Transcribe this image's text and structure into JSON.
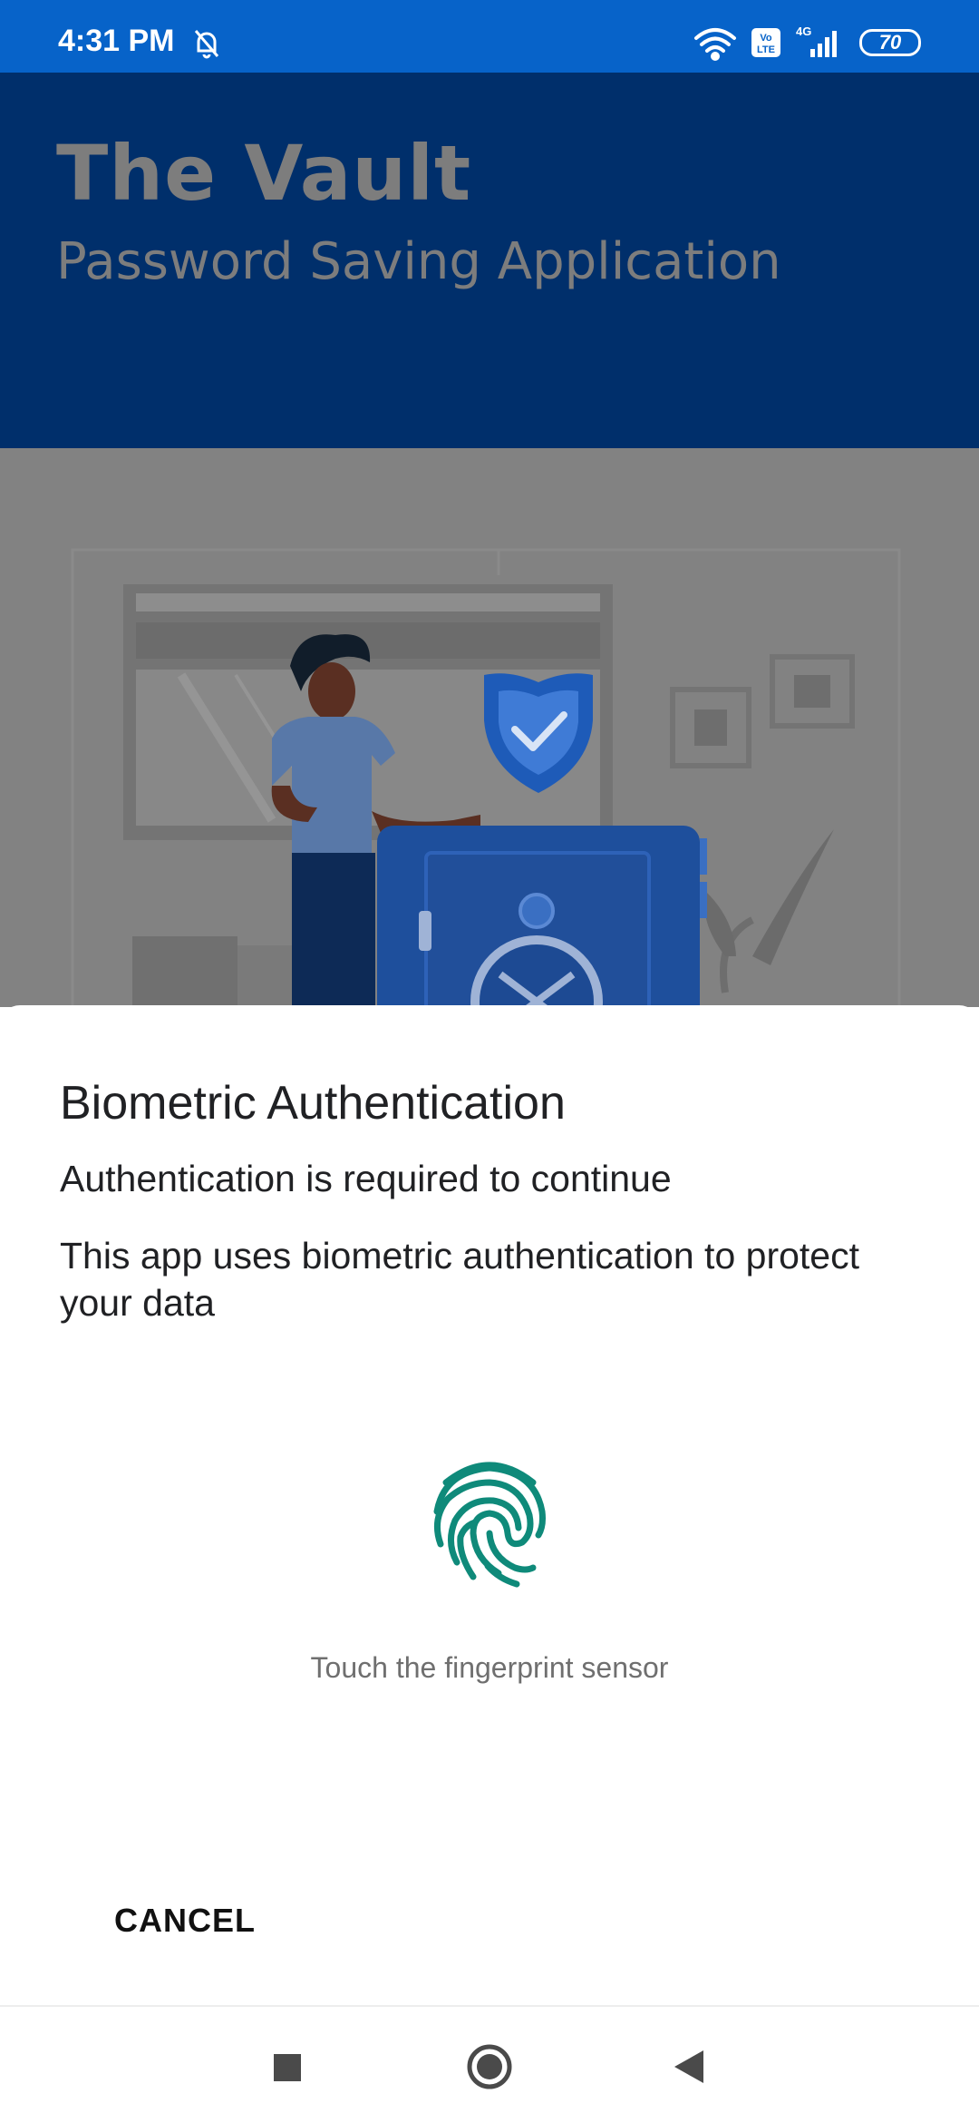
{
  "status_bar": {
    "time": "4:31 PM",
    "battery": "70",
    "icons": [
      "mute-bell-icon",
      "wifi-icon",
      "volte-icon",
      "signal-4g-icon",
      "battery-icon"
    ]
  },
  "app": {
    "title": "The Vault",
    "subtitle": "Password Saving Application",
    "colors": {
      "header": "#002f6b",
      "status_bar": "#0763c9",
      "accent": "#0f8a7a"
    }
  },
  "dialog": {
    "title": "Biometric Authentication",
    "subtitle": "Authentication is required to continue",
    "description": "This app uses biometric authentication to protect your data",
    "hint": "Touch the fingerprint sensor",
    "cancel_label": "CANCEL",
    "icon": "fingerprint-icon"
  },
  "nav": {
    "icons": [
      "recents-icon",
      "home-icon",
      "back-icon"
    ]
  }
}
